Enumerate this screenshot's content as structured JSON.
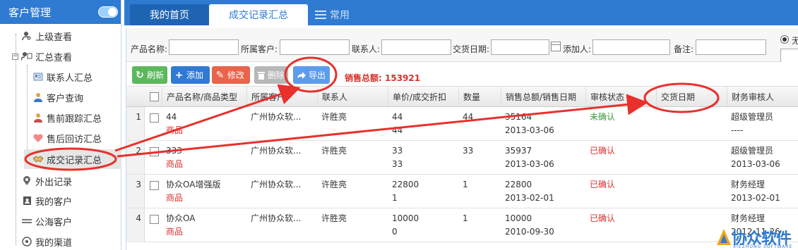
{
  "sidebar": {
    "title": "客户管理",
    "items": [
      {
        "label": "上级查看",
        "icon": "user-search-icon"
      },
      {
        "label": "汇总查看",
        "icon": "chart-user-icon"
      },
      {
        "label": "联系人汇总",
        "icon": "contacts-card-icon"
      },
      {
        "label": "客户查询",
        "icon": "user-icon"
      },
      {
        "label": "售前跟踪汇总",
        "icon": "presale-user-icon"
      },
      {
        "label": "售后回访汇总",
        "icon": "heart-icon"
      },
      {
        "label": "成交记录汇总",
        "icon": "handshake-icon"
      },
      {
        "label": "外出记录",
        "icon": "location-pin-icon"
      },
      {
        "label": "我的客户",
        "icon": "contact-book-icon"
      },
      {
        "label": "公海客户",
        "icon": "lines-icon"
      },
      {
        "label": "我的渠道",
        "icon": "channel-icon"
      }
    ]
  },
  "tabs": {
    "home": "我的首页",
    "current": "成交记录汇总",
    "common": "常用"
  },
  "filter": {
    "product_name": "产品名称:",
    "customer": "所属客户:",
    "contact": "联系人:",
    "deal_date": "交货日期:",
    "adder": "添加人:",
    "remark": "备注:",
    "radio_label": "无"
  },
  "toolbar": {
    "refresh": "刷新",
    "add": "添加",
    "edit": "修改",
    "delete": "删除",
    "export": "导出",
    "sales_total_label": "销售总额:",
    "sales_total_value": "153921"
  },
  "grid": {
    "headers": [
      "产品名称/商品类型",
      "所属客户",
      "联系人",
      "单价/成交折扣",
      "数量",
      "销售总额/销售日期",
      "审核状态",
      "交货日期",
      "财务审核人"
    ],
    "rows": [
      {
        "num": "1",
        "name": "44",
        "type": "商品",
        "customer": "广州协众软...",
        "contact": "许胜亮",
        "price": "44",
        "discount": "44",
        "qty": "44",
        "total": "35164",
        "date": "2013-03-06",
        "status": "未确认",
        "status_kind": "green",
        "delivery": "",
        "auditor": "超级管理员",
        "audit_date": "----"
      },
      {
        "num": "2",
        "name": "333",
        "type": "商品",
        "customer": "广州协众软...",
        "contact": "许胜亮",
        "price": "33",
        "discount": "33",
        "qty": "33",
        "total": "35937",
        "date": "2013-03-06",
        "status": "已确认",
        "status_kind": "red",
        "delivery": "",
        "auditor": "超级管理员",
        "audit_date": "2013-03-06"
      },
      {
        "num": "3",
        "name": "协众OA增强版",
        "type": "商品",
        "customer": "广州协众软...",
        "contact": "许胜亮",
        "price": "22800",
        "discount": "1",
        "qty": "1",
        "total": "22800",
        "date": "2013-02-01",
        "status": "已确认",
        "status_kind": "red",
        "delivery": "",
        "auditor": "财务经理",
        "audit_date": "2013-02-01"
      },
      {
        "num": "4",
        "name": "协众OA",
        "type": "商品",
        "customer": "广州协众软...",
        "contact": "许胜亮",
        "price": "10000",
        "discount": "0",
        "qty": "1",
        "total": "10000",
        "date": "2010-09-30",
        "status": "已确认",
        "status_kind": "red",
        "delivery": "",
        "auditor": "财务经理",
        "audit_date": "2012-11-26"
      }
    ]
  },
  "logo": {
    "text": "协众软件",
    "sub": "XIEZHONG SOFTWARE"
  },
  "colors": {
    "brand_blue": "#2f7bd2",
    "annotation_red": "#e8302c",
    "confirmed_red": "#d9302c",
    "unconfirmed_green": "#3a9a3a"
  }
}
